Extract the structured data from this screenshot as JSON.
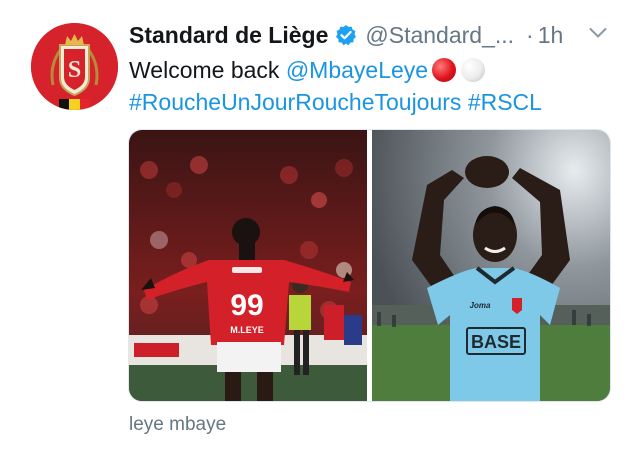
{
  "account": {
    "name": "Standard de Liège",
    "handle": "@Standard_...",
    "separator": "·",
    "time": "1h",
    "avatar_icon": "standard-liege-crest-icon",
    "verified_icon": "verified-badge-icon",
    "menu_icon": "chevron-down-icon"
  },
  "tweet": {
    "welcome": "Welcome back",
    "mention": "@MbayeLeye",
    "hashtag1": "#RoucheUnJourRoucheToujours",
    "hashtag2": "#RSCL"
  },
  "media": {
    "photo1": {
      "jersey_number": "99",
      "jersey_name": "M.LEYE"
    },
    "photo2": {
      "shirt_sponsor": "BASE",
      "shirt_brand": "Joma"
    }
  },
  "footer": {
    "text": "leye mbaye"
  },
  "colors": {
    "link": "#1b95e0",
    "secondary": "#657786",
    "brand_red": "#d6232b",
    "verified": "#1da1f2"
  }
}
